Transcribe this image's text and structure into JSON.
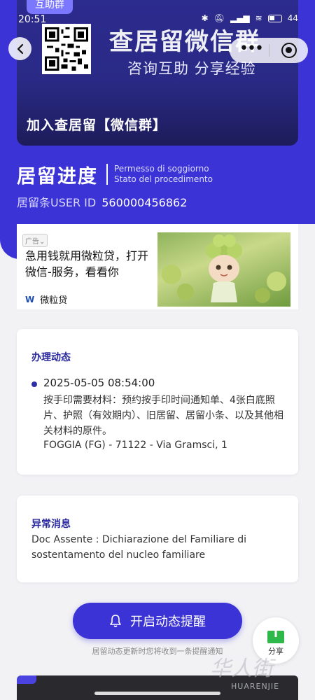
{
  "status_bar": {
    "time": "20:51",
    "battery": "44"
  },
  "banner": {
    "tag": "互助群",
    "title": "查居留微信群",
    "subtitle": "咨询互助 分享经验",
    "join_label": "加入查居留【微信群】"
  },
  "header": {
    "title": "居留进度",
    "subtitle_line1": "Permesso di soggiorno",
    "subtitle_line2": "Stato del procedimento",
    "user_id_label": "居留条USER ID",
    "user_id": "560000456862"
  },
  "ad": {
    "tag": "广告",
    "text": "急用钱就用微粒贷，打开微信-服务，看看你",
    "brand": "微粒贷"
  },
  "progress": {
    "heading": "办理动态",
    "entries": [
      {
        "datetime": "2025-05-05 08:54:00",
        "description": "按手印需要材料：预约按手印时间通知单、4张白底照片、护照（有效期内）、旧居留、居留小条、以及其他相关材料的原件。",
        "address": "FOGGIA (FG) - 71122 - Via Gramsci, 1"
      }
    ]
  },
  "warning": {
    "heading": "异常消息",
    "text": "Doc Assente : Dichiarazione del Familiare di sostentamento del nucleo familiare"
  },
  "cta": {
    "label": "开启动态提醒",
    "note": "居留动态更新时您将收到一条提醒通知"
  },
  "share": {
    "label": "分享"
  },
  "watermark": {
    "text": "华人街",
    "sub": "HUARENJIE"
  }
}
